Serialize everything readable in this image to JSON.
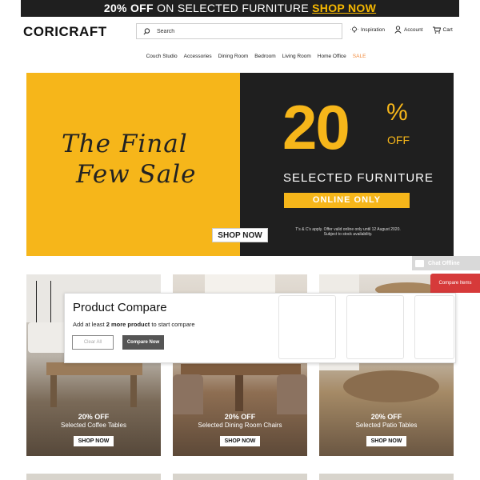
{
  "promo": {
    "bold_text": "20% OFF",
    "regular_text": "ON SELECTED FURNITURE",
    "link_text": "SHOP NOW"
  },
  "header": {
    "logo": "CORICRAFT",
    "search_placeholder": "Search",
    "links": {
      "inspiration": "Inspiration",
      "account": "Account",
      "cart": "Cart"
    }
  },
  "nav": [
    "Couch Studio",
    "Accessories",
    "Dining Room",
    "Bedroom",
    "Living Room",
    "Home Office",
    "SALE"
  ],
  "hero": {
    "script_line1": "The Final",
    "script_line2": "Few Sale",
    "shop_now": "SHOP NOW",
    "big_number": "20",
    "percent": "%",
    "off": "OFF",
    "selected": "SELECTED FURNITURE",
    "online_only": "ONLINE ONLY",
    "terms_line1": "T's & C's apply. Offer valid online only until 12 August 2020.",
    "terms_line2": "Subject to stock availability."
  },
  "chat": {
    "label": "Chat Offline"
  },
  "compare_tab": "Compare Items",
  "compare": {
    "title": "Product Compare",
    "hint_pre": "Add at least ",
    "hint_bold": "2 more product",
    "hint_post": " to start compare",
    "clear_all": "Clear All",
    "compare_now": "Compare Now"
  },
  "tiles": [
    {
      "pct": "20% OFF",
      "name": "Selected Coffee Tables",
      "shop": "SHOP NOW"
    },
    {
      "pct": "20% OFF",
      "name": "Selected Dining Room Chairs",
      "shop": "SHOP NOW"
    },
    {
      "pct": "20% OFF",
      "name": "Selected Patio Tables",
      "shop": "SHOP NOW"
    }
  ],
  "colors": {
    "accent": "#f6b61a",
    "dark": "#1f1f1f",
    "sale": "#f08a3c",
    "compare_tab": "#d63a3a"
  }
}
